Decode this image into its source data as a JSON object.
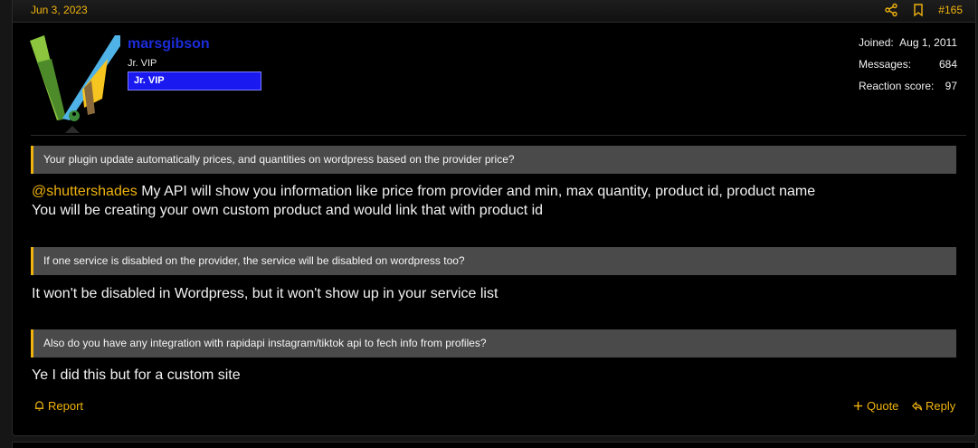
{
  "post": {
    "date": "Jun 3, 2023",
    "number": "#165",
    "share_icon": "share-icon",
    "bookmark_icon": "bookmark-icon"
  },
  "user": {
    "name": "marsgibson",
    "title": "Jr. VIP",
    "banner": "Jr. VIP",
    "colors": {
      "name": "#1b2cd9",
      "banner_bg": "#1a1af0"
    },
    "stats": [
      {
        "label": "Joined:",
        "value": "Aug 1, 2011"
      },
      {
        "label": "Messages:",
        "value": "684"
      },
      {
        "label": "Reaction score:",
        "value": "97"
      }
    ]
  },
  "content": {
    "quote1": "Your plugin update automatically prices, and quantities on wordpress based on the provider price?",
    "mention": "@shuttershades",
    "reply1_line1": " My API will show you information like price from provider and min, max quantity, product id, product name",
    "reply1_line2": "You will be creating your own custom product and would link that with product id",
    "quote2": "If one service is disabled on the provider, the service will be disabled on wordpress too?",
    "reply2": "It won't be disabled in Wordpress, but it won't show up in your service list",
    "quote3": "Also do you have any integration with rapidapi instagram/tiktok api to fech info from profiles?",
    "reply3": "Ye I did this but for a custom site"
  },
  "actions": {
    "report": "Report",
    "quote": "Quote",
    "reply": "Reply"
  },
  "theme": {
    "accent": "#f0b30e",
    "quote_bg": "#4a4a4a",
    "background": "#000000"
  }
}
